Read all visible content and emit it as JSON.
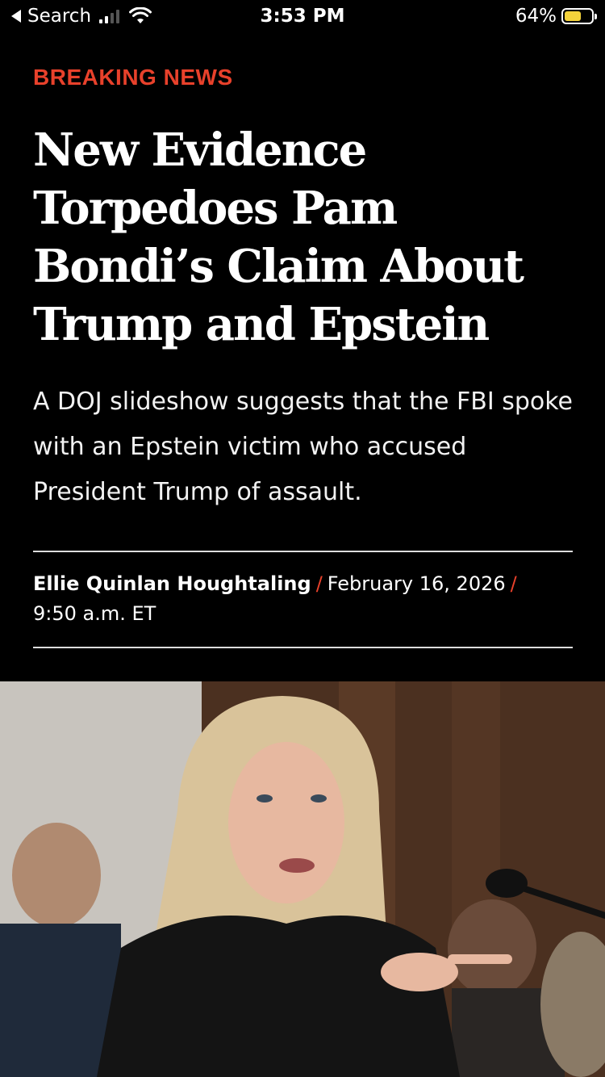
{
  "status_bar": {
    "back_label": "Search",
    "time": "3:53 PM",
    "battery_percent": "64%",
    "battery_level": 0.64,
    "battery_color": "#f5d33b"
  },
  "article": {
    "kicker": "BREAKING NEWS",
    "kicker_color": "#e8412b",
    "headline": "New Evidence Torpedoes Pam Bondi’s Claim About Trump and Epstein",
    "dek": "A DOJ slideshow suggests that the FBI spoke with an Epstein victim who accused President Trump of assault.",
    "byline": {
      "author": "Ellie Quinlan Houghtaling",
      "date": "February 16, 2026",
      "time": "9:50 a.m. ET",
      "separator": "/"
    }
  },
  "hero_image": {
    "icon": "photo-of-speaker-at-hearing"
  }
}
